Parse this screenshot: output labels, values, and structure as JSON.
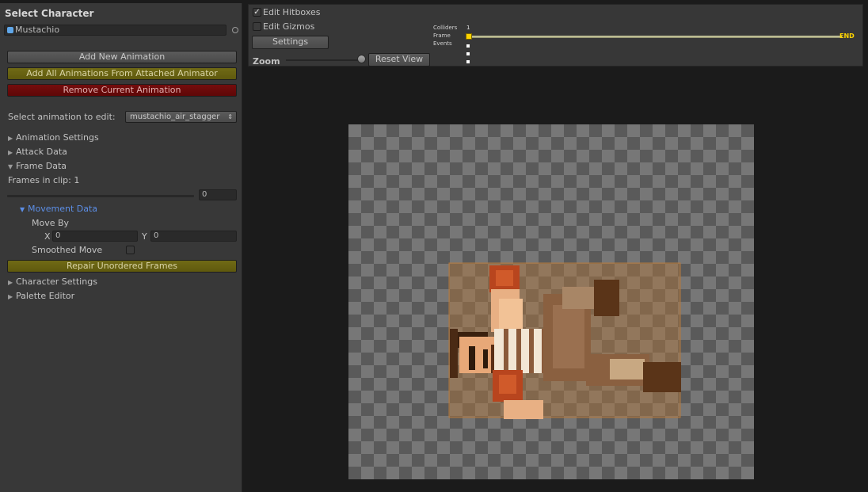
{
  "left_panel": {
    "title": "Select Character",
    "character_field": "Mustachio",
    "buttons": {
      "add_new": "Add New Animation",
      "add_all": "Add All Animations From Attached Animator",
      "remove": "Remove Current Animation",
      "repair": "Repair Unordered Frames"
    },
    "select_label": "Select animation to edit:",
    "select_value": "mustachio_air_stagger",
    "foldouts": {
      "animation_settings": "Animation Settings",
      "attack_data": "Attack Data",
      "frame_data": "Frame Data",
      "movement_data": "Movement Data",
      "character_settings": "Character Settings",
      "palette_editor": "Palette Editor"
    },
    "frames_in_clip": "Frames in clip: 1",
    "frame_slider_value": "0",
    "move_by_label": "Move By",
    "x_label": "X",
    "x_value": "0",
    "y_label": "Y",
    "y_value": "0",
    "smoothed_move_label": "Smoothed Move",
    "smoothed_move_checked": false
  },
  "toolbar": {
    "edit_hitboxes_label": "Edit Hitboxes",
    "edit_hitboxes_checked": true,
    "edit_gizmos_label": "Edit Gizmos",
    "edit_gizmos_checked": false,
    "settings_button": "Settings",
    "zoom_label": "Zoom",
    "zoom_level": 0.95,
    "reset_view_button": "Reset View"
  },
  "timeline": {
    "colliders_label": "Colliders",
    "colliders_count": "1",
    "frame_label": "Frame",
    "events_label": "Events",
    "end_label": "END"
  },
  "colors": {
    "accent_yellow": "#ffd400",
    "button_yellow": "#6b6512",
    "button_red": "#6d0a0a",
    "link_blue": "#5c8ee6"
  }
}
